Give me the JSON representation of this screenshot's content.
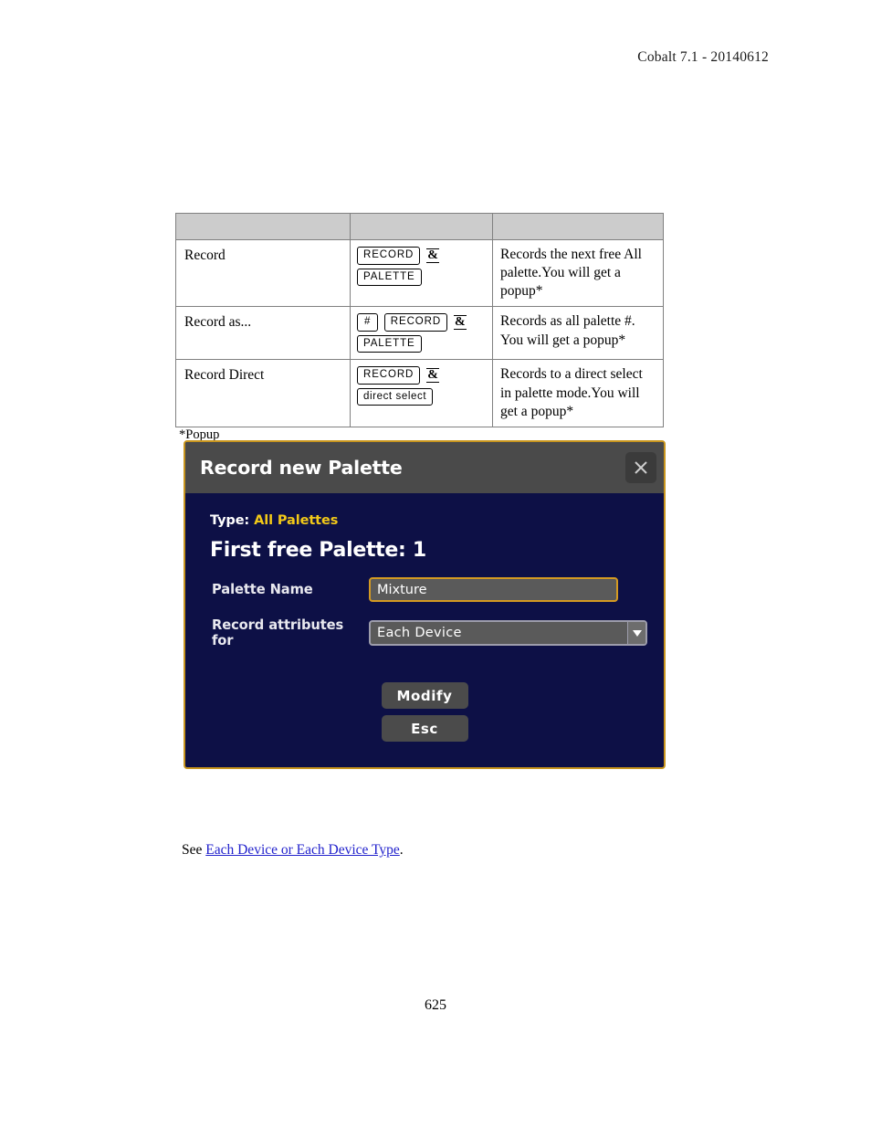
{
  "header": {
    "product_version": "Cobalt 7.1 - 20140612"
  },
  "table": {
    "columns": [
      "",
      "",
      ""
    ],
    "rows": [
      {
        "action": "Record",
        "keys": [
          [
            {
              "type": "key",
              "label": "RECORD"
            },
            {
              "type": "amp",
              "label": "&"
            }
          ],
          [
            {
              "type": "key",
              "label": "PALETTE"
            }
          ]
        ],
        "description": "Records the next free All palette.You will get a popup*"
      },
      {
        "action": "Record as...",
        "keys": [
          [
            {
              "type": "key",
              "label": "#"
            },
            {
              "type": "key",
              "label": "RECORD"
            },
            {
              "type": "amp",
              "label": "&"
            }
          ],
          [
            {
              "type": "key",
              "label": "PALETTE"
            }
          ]
        ],
        "description": "Records as all palette #. You will get a popup*"
      },
      {
        "action": "Record Direct",
        "keys": [
          [
            {
              "type": "key",
              "label": "RECORD"
            },
            {
              "type": "amp",
              "label": "&"
            }
          ],
          [
            {
              "type": "key",
              "label": "direct select"
            }
          ]
        ],
        "description": "Records to a direct select in palette mode.You will get a popup*"
      }
    ]
  },
  "popup_caption": "*Popup",
  "dialog": {
    "title": "Record new Palette",
    "close_icon": "close-icon",
    "type_label": "Type:",
    "type_value": "All Palettes",
    "first_free_text": "First free Palette: 1",
    "fields": [
      {
        "label": "Palette Name",
        "value": "Mixture"
      },
      {
        "label": "Record attributes for",
        "value": "Each Device"
      }
    ],
    "buttons": [
      {
        "label": "Modify"
      },
      {
        "label": "Esc"
      }
    ],
    "colors": {
      "body_background": "#0d1046",
      "titlebar": "#4a4a4a",
      "border": "#c8951e",
      "accent_yellow": "#f2c918",
      "input_border_active": "#d49a22"
    }
  },
  "see_line": {
    "prefix": "See ",
    "link_text": "Each Device or Each Device Type",
    "suffix": "."
  },
  "page_number": "625"
}
